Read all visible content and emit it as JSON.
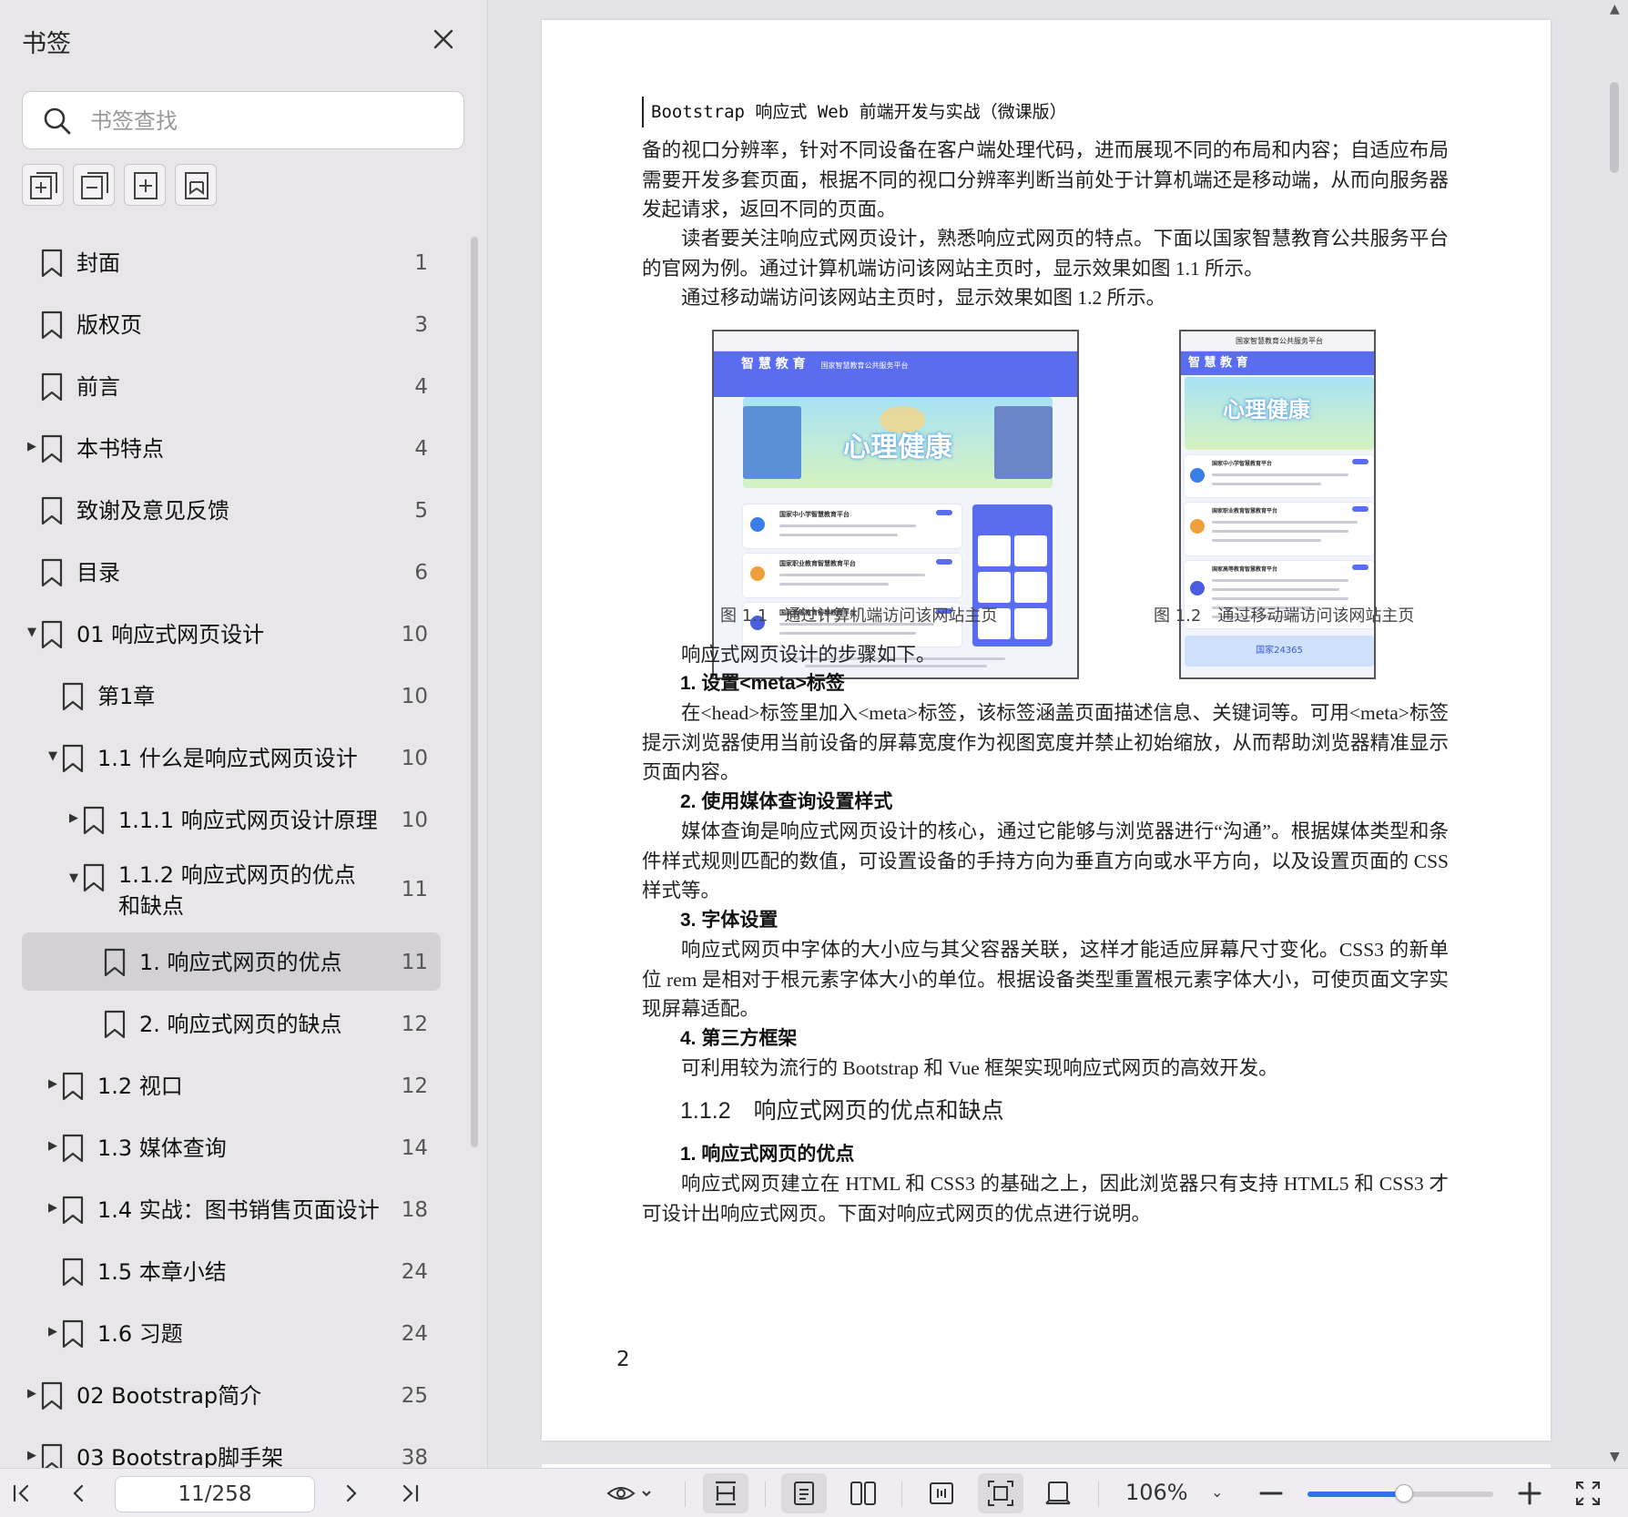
{
  "sidebar": {
    "title": "书签",
    "search_placeholder": "书签查找",
    "tools": [
      "add-bookmark-icon",
      "remove-bookmark-icon",
      "add-sub-bookmark-icon",
      "bookmark-page-icon"
    ],
    "items": [
      {
        "label": "封面",
        "page": "1",
        "level": 0,
        "caret": ""
      },
      {
        "label": "版权页",
        "page": "3",
        "level": 0,
        "caret": ""
      },
      {
        "label": "前言",
        "page": "4",
        "level": 0,
        "caret": ""
      },
      {
        "label": "本书特点",
        "page": "4",
        "level": 0,
        "caret": "▶"
      },
      {
        "label": "致谢及意见反馈",
        "page": "5",
        "level": 0,
        "caret": ""
      },
      {
        "label": "目录",
        "page": "6",
        "level": 0,
        "caret": ""
      },
      {
        "label": "01 响应式网页设计",
        "page": "10",
        "level": 0,
        "caret": "▼"
      },
      {
        "label": "第1章",
        "page": "10",
        "level": 1,
        "caret": ""
      },
      {
        "label": "1.1  什么是响应式网页设计",
        "page": "10",
        "level": 1,
        "caret": "▼"
      },
      {
        "label": "1.1.1  响应式网页设计原理",
        "page": "10",
        "level": 2,
        "caret": "▶"
      },
      {
        "label": "1.1.2  响应式网页的优点和缺点",
        "page": "11",
        "level": 2,
        "caret": "▼"
      },
      {
        "label": "1.  响应式网页的优点",
        "page": "11",
        "level": 3,
        "caret": "",
        "selected": true
      },
      {
        "label": "2.  响应式网页的缺点",
        "page": "12",
        "level": 3,
        "caret": ""
      },
      {
        "label": "1.2  视口",
        "page": "12",
        "level": 1,
        "caret": "▶"
      },
      {
        "label": "1.3  媒体查询",
        "page": "14",
        "level": 1,
        "caret": "▶"
      },
      {
        "label": "1.4  实战：图书销售页面设计",
        "page": "18",
        "level": 1,
        "caret": "▶"
      },
      {
        "label": "1.5  本章小结",
        "page": "24",
        "level": 1,
        "caret": ""
      },
      {
        "label": "1.6  习题",
        "page": "24",
        "level": 1,
        "caret": "▶"
      },
      {
        "label": "02 Bootstrap简介",
        "page": "25",
        "level": 0,
        "caret": "▶"
      },
      {
        "label": "03 Bootstrap脚手架",
        "page": "38",
        "level": 0,
        "caret": "▶"
      }
    ]
  },
  "document": {
    "running_head": "Bootstrap 响应式 Web 前端开发与实战（微课版）",
    "para1": "备的视口分辨率，针对不同设备在客户端处理代码，进而展现不同的布局和内容；自适应布局需要开发多套页面，根据不同的视口分辨率判断当前处于计算机端还是移动端，从而向服务器发起请求，返回不同的页面。",
    "para2": "读者要关注响应式网页设计，熟悉响应式网页的特点。下面以国家智慧教育公共服务平台的官网为例。通过计算机端访问该网站主页时，显示效果如图 1.1 所示。",
    "para3": "通过移动端访问该网站主页时，显示效果如图 1.2 所示。",
    "figure1": {
      "caption": "图 1.1　通过计算机端访问该网站主页",
      "brand": "智 慧 教 育",
      "brand_sub": "国家智慧教育公共服务平台",
      "banner": "心理健康",
      "cards": [
        "国家中小学智慧教育平台",
        "国家职业教育智慧教育平台",
        "国家高等教育智慧教育平台"
      ]
    },
    "figure2": {
      "caption": "图 1.2　通过移动端访问该网站主页",
      "topbar": "国家智慧教育公共服务平台",
      "brand": "智 慧 教 育",
      "banner": "心理健康",
      "cards": [
        "国家中小学智慧教育平台",
        "国家职业教育智慧教育平台",
        "国家高等教育智慧教育平台"
      ],
      "footer": "国家24365"
    },
    "steps_intro": "响应式网页设计的步骤如下。",
    "h_step1": "1.  设置<meta>标签",
    "step1": "在<head>标签里加入<meta>标签，该标签涵盖页面描述信息、关键词等。可用<meta>标签提示浏览器使用当前设备的屏幕宽度作为视图宽度并禁止初始缩放，从而帮助浏览器精准显示页面内容。",
    "h_step2": "2.  使用媒体查询设置样式",
    "step2": "媒体查询是响应式网页设计的核心，通过它能够与浏览器进行“沟通”。根据媒体类型和条件样式规则匹配的数值，可设置设备的手持方向为垂直方向或水平方向，以及设置页面的 CSS 样式等。",
    "h_step3": "3.  字体设置",
    "step3": "响应式网页中字体的大小应与其父容器关联，这样才能适应屏幕尺寸变化。CSS3 的新单位 rem 是相对于根元素字体大小的单位。根据设备类型重置根元素字体大小，可使页面文字实现屏幕适配。",
    "h_step4": "4.  第三方框架",
    "step4": "可利用较为流行的 Bootstrap 和 Vue 框架实现响应式网页的高效开发。",
    "section_title": "1.1.2　响应式网页的优点和缺点",
    "h_adv": "1.  响应式网页的优点",
    "adv": "响应式网页建立在 HTML 和 CSS3 的基础之上，因此浏览器只有支持 HTML5 和 CSS3 才可设计出响应式网页。下面对响应式网页的优点进行说明。",
    "page_number": "2"
  },
  "toolbar": {
    "page_indicator": "11/258",
    "zoom": "106%",
    "zoom_fraction": 0.52,
    "accent": "#2f74e6"
  }
}
